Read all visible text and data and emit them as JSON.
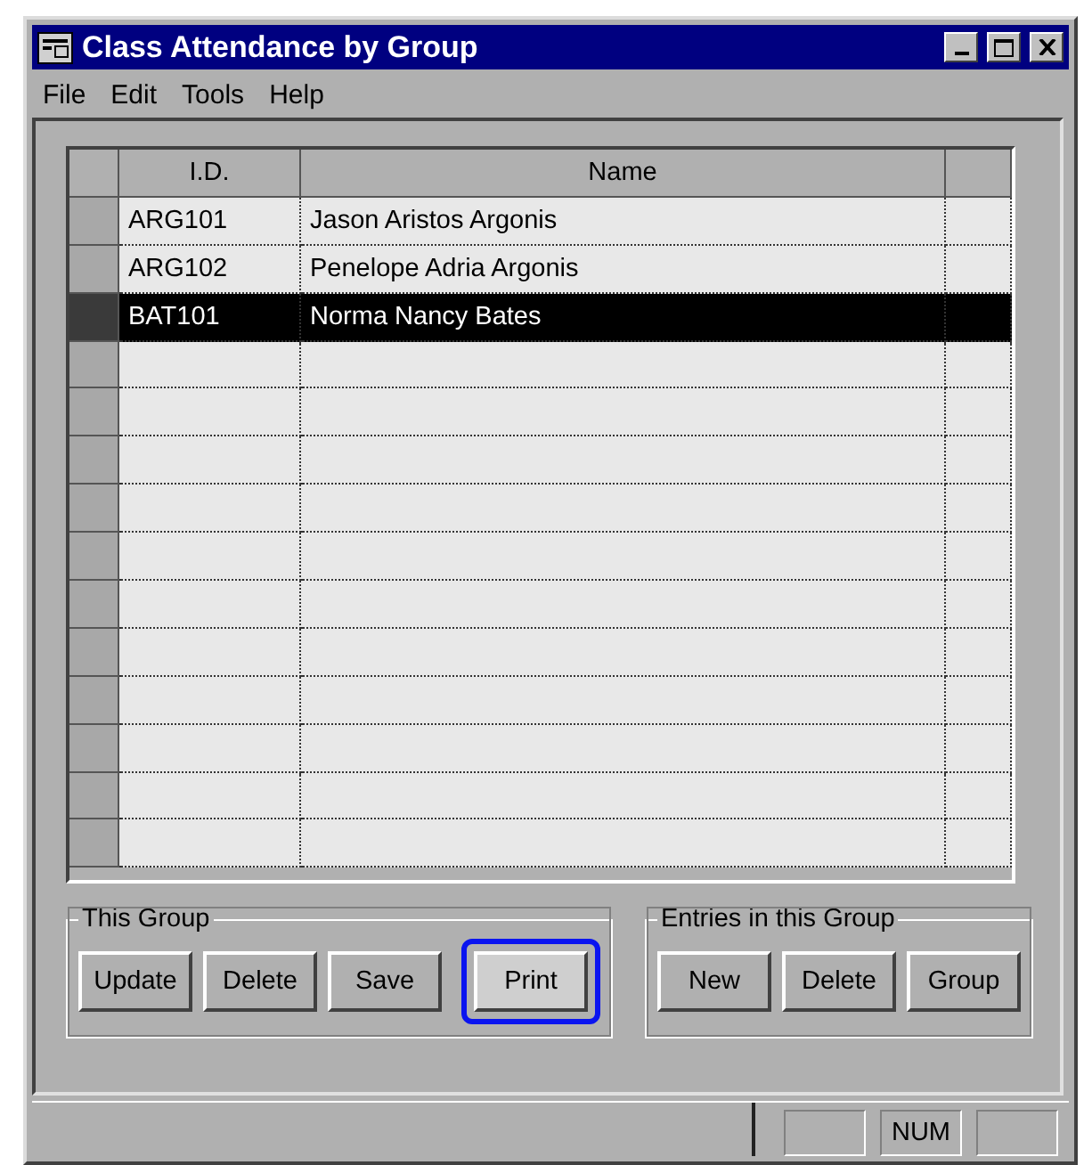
{
  "window": {
    "title": "Class Attendance by Group"
  },
  "menu": [
    "File",
    "Edit",
    "Tools",
    "Help"
  ],
  "table": {
    "columns": [
      "I.D.",
      "Name"
    ],
    "rows": [
      {
        "id": "ARG101",
        "name": "Jason Aristos Argonis",
        "selected": false
      },
      {
        "id": "ARG102",
        "name": "Penelope Adria Argonis",
        "selected": false
      },
      {
        "id": "BAT101",
        "name": "Norma Nancy Bates",
        "selected": true
      },
      {
        "selected": false
      },
      {
        "selected": false
      },
      {
        "selected": false
      },
      {
        "selected": false
      },
      {
        "selected": false
      },
      {
        "selected": false
      },
      {
        "selected": false
      },
      {
        "selected": false
      },
      {
        "selected": false
      },
      {
        "selected": false
      },
      {
        "selected": false
      }
    ]
  },
  "groups": [
    {
      "title": "This Group",
      "buttons": [
        {
          "label": "Update",
          "highlighted": false
        },
        {
          "label": "Delete",
          "highlighted": false
        },
        {
          "label": "Save",
          "highlighted": false
        },
        {
          "label": "Print",
          "highlighted": true
        }
      ]
    },
    {
      "title": "Entries in this Group",
      "buttons": [
        {
          "label": "New",
          "highlighted": false
        },
        {
          "label": "Delete",
          "highlighted": false
        },
        {
          "label": "Group",
          "highlighted": false
        }
      ]
    }
  ],
  "status_bar": {
    "indicators": [
      "NUM"
    ]
  }
}
